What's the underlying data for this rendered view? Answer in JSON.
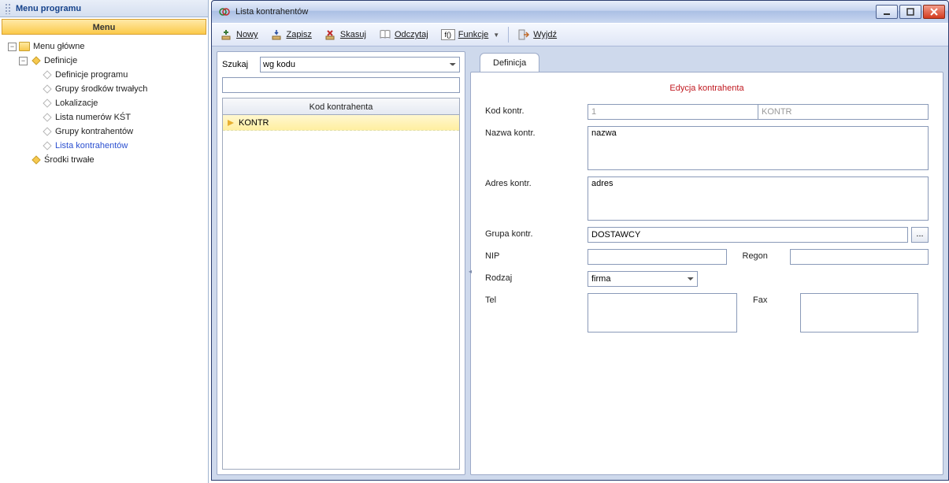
{
  "sidebar": {
    "title": "Menu programu",
    "heading": "Menu",
    "root": "Menu główne",
    "definicje": {
      "label": "Definicje",
      "children": [
        "Definicje programu",
        "Grupy środków trwałych",
        "Lokalizacje",
        "Lista numerów KŚT",
        "Grupy kontrahentów",
        "Lista kontrahentów"
      ]
    },
    "srodki": "Środki trwałe"
  },
  "window": {
    "title": "Lista kontrahentów"
  },
  "toolbar": {
    "nowy": "Nowy",
    "zapisz": "Zapisz",
    "skasuj": "Skasuj",
    "odczytaj": "Odczytaj",
    "funkcje": "Funkcje",
    "wyjdz": "Wyjdź",
    "f0": "f()"
  },
  "search": {
    "label": "Szukaj",
    "mode": "wg kodu",
    "filter": ""
  },
  "grid": {
    "header": "Kod kontrahenta",
    "rows": [
      "KONTR"
    ]
  },
  "tab": {
    "label": "Definicja"
  },
  "form": {
    "title": "Edycja kontrahenta",
    "labels": {
      "kod": "Kod kontr.",
      "nazwa": "Nazwa kontr.",
      "adres": "Adres kontr.",
      "grupa": "Grupa kontr.",
      "nip": "NIP",
      "regon": "Regon",
      "rodzaj": "Rodzaj",
      "tel": "Tel",
      "fax": "Fax"
    },
    "values": {
      "kod_id": "1",
      "kod": "KONTR",
      "nazwa": "nazwa",
      "adres": "adres",
      "grupa": "DOSTAWCY",
      "nip": "",
      "regon": "",
      "rodzaj": "firma",
      "tel": "",
      "fax": ""
    },
    "pick": "..."
  }
}
